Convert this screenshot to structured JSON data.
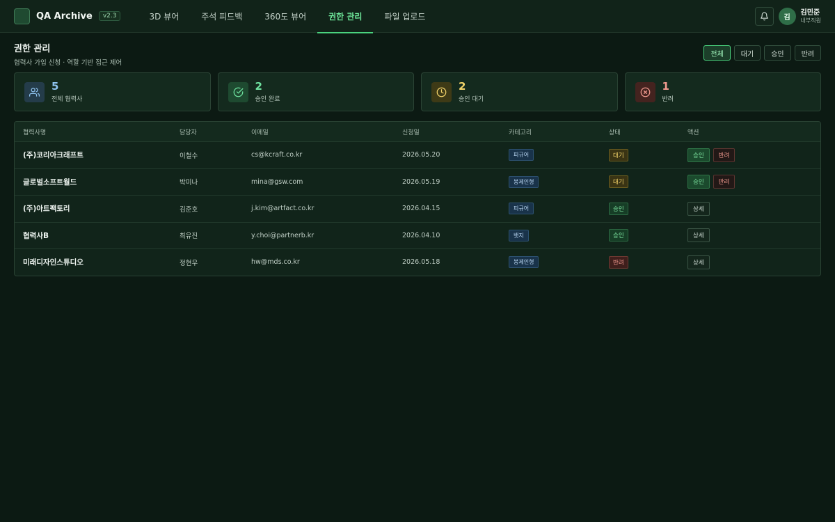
{
  "app": {
    "title": "QA Archive",
    "version": "v2.3"
  },
  "nav": [
    {
      "label": "3D 뷰어"
    },
    {
      "label": "주석 피드백"
    },
    {
      "label": "360도 뷰어"
    },
    {
      "label": "권한 관리",
      "active": true
    },
    {
      "label": "파일 업로드"
    }
  ],
  "user": {
    "avatar_initial": "김",
    "name": "김민준",
    "role": "내부직원"
  },
  "page": {
    "title": "권한 관리",
    "subtitle": "협력사 가입 신청 · 역할 기반 접근 제어"
  },
  "filters": [
    {
      "label": "전체",
      "active": true
    },
    {
      "label": "대기"
    },
    {
      "label": "승인"
    },
    {
      "label": "반려"
    }
  ],
  "stats": [
    {
      "value": "5",
      "label": "전체 협력사",
      "icon": "users-icon",
      "color": "#8fc3ef"
    },
    {
      "value": "2",
      "label": "승인 완료",
      "icon": "check-circle-icon",
      "color": "#6fe3a0"
    },
    {
      "value": "2",
      "label": "승인 대기",
      "icon": "clock-icon",
      "color": "#f3d46a"
    },
    {
      "value": "1",
      "label": "반려",
      "icon": "x-circle-icon",
      "color": "#f29a8f"
    }
  ],
  "table": {
    "headers": [
      "협력사명",
      "담당자",
      "이메일",
      "신청일",
      "카테고리",
      "상태",
      "액션"
    ],
    "rows": [
      {
        "company": "(주)코리아크래프트",
        "person": "이철수",
        "email": "cs@kcraft.co.kr",
        "date": "2026.05.20",
        "category": "피규어",
        "status": "대기",
        "status_type": "pending",
        "actions": [
          "승인",
          "반려"
        ]
      },
      {
        "company": "글로벌소프트월드",
        "person": "박미나",
        "email": "mina@gsw.com",
        "date": "2026.05.19",
        "category": "봉제인형",
        "status": "대기",
        "status_type": "pending",
        "actions": [
          "승인",
          "반려"
        ]
      },
      {
        "company": "(주)아트팩토리",
        "person": "김준호",
        "email": "j.kim@artfact.co.kr",
        "date": "2026.04.15",
        "category": "피규어",
        "status": "승인",
        "status_type": "approved",
        "actions": [
          "상세"
        ]
      },
      {
        "company": "협력사B",
        "person": "최유진",
        "email": "y.choi@partnerb.kr",
        "date": "2026.04.10",
        "category": "뱃지",
        "status": "승인",
        "status_type": "approved",
        "actions": [
          "상세"
        ]
      },
      {
        "company": "미래디자인스튜디오",
        "person": "정현우",
        "email": "hw@mds.co.kr",
        "date": "2026.05.18",
        "category": "봉제인형",
        "status": "반려",
        "status_type": "rejected",
        "actions": [
          "상세"
        ]
      }
    ]
  },
  "colors": {
    "accent": "#4ad37e",
    "background": "#0c1a13"
  }
}
